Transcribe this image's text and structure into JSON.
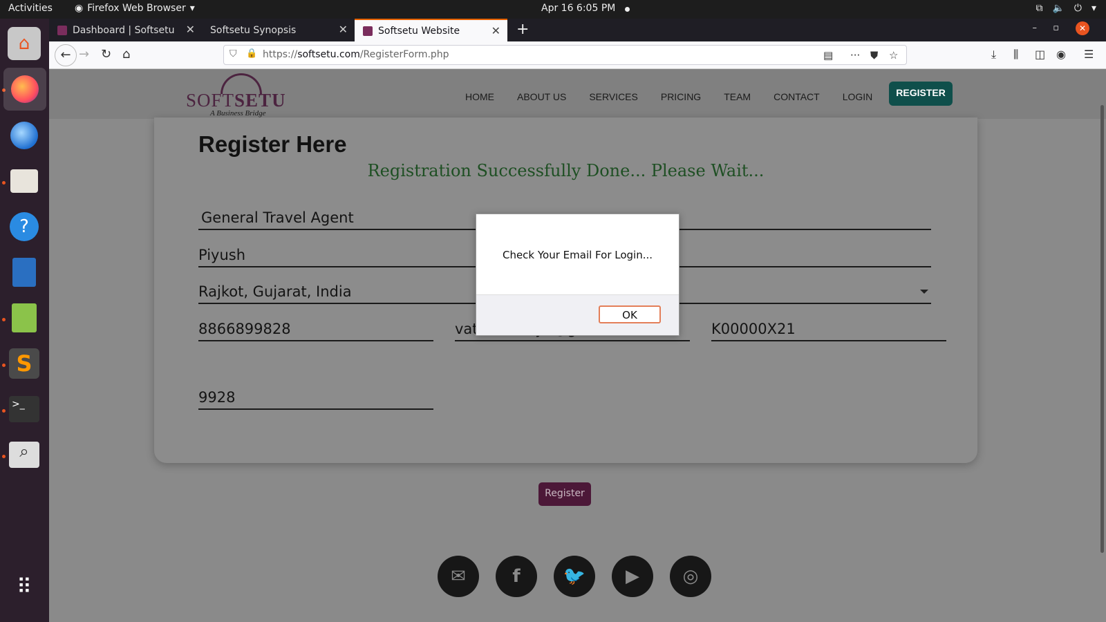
{
  "topbar": {
    "activities": "Activities",
    "app_name": "Firefox Web Browser",
    "clock": "Apr 16  6:05 PM"
  },
  "dock": {
    "items": [
      "ubuntu-software-icon",
      "firefox-icon",
      "thunderbird-icon",
      "files-icon",
      "help-icon",
      "writer-icon",
      "image-viewer-icon",
      "sublime-text-icon",
      "terminal-icon",
      "screenshot-icon",
      "app-grid-icon"
    ]
  },
  "browser": {
    "tabs": [
      {
        "title": "Dashboard | Softsetu"
      },
      {
        "title": "Softsetu Synopsis"
      },
      {
        "title": "Softsetu Website"
      }
    ],
    "url_prefix": "https://",
    "url_domain": "softsetu.com",
    "url_path": "/RegisterForm.php"
  },
  "site": {
    "logo": {
      "brand_light": "SOFT",
      "brand_bold": "SETU",
      "tagline": "A Business Bridge"
    },
    "nav": [
      "HOME",
      "ABOUT US",
      "SERVICES",
      "PRICING",
      "TEAM",
      "CONTACT",
      "LOGIN"
    ],
    "nav_cta": "REGISTER",
    "brand_color": "#0f4f4b"
  },
  "form": {
    "heading": "Register Here",
    "success_message": "Registration Successfully Done... Please Wait...",
    "fields": {
      "business_type": "General Travel Agent",
      "name": "Piyush",
      "location": "Rajkot, Gujarat, India",
      "phone": "8866899828",
      "email": "vatsehotaliya@gmail.com",
      "code": "K00000X21",
      "pin": "9928"
    },
    "submit_label": "Register"
  },
  "social": [
    "envelope-icon",
    "facebook-icon",
    "twitter-icon",
    "youtube-icon",
    "instagram-icon"
  ],
  "dialog": {
    "message": "Check Your Email For Login...",
    "ok_label": "OK"
  }
}
